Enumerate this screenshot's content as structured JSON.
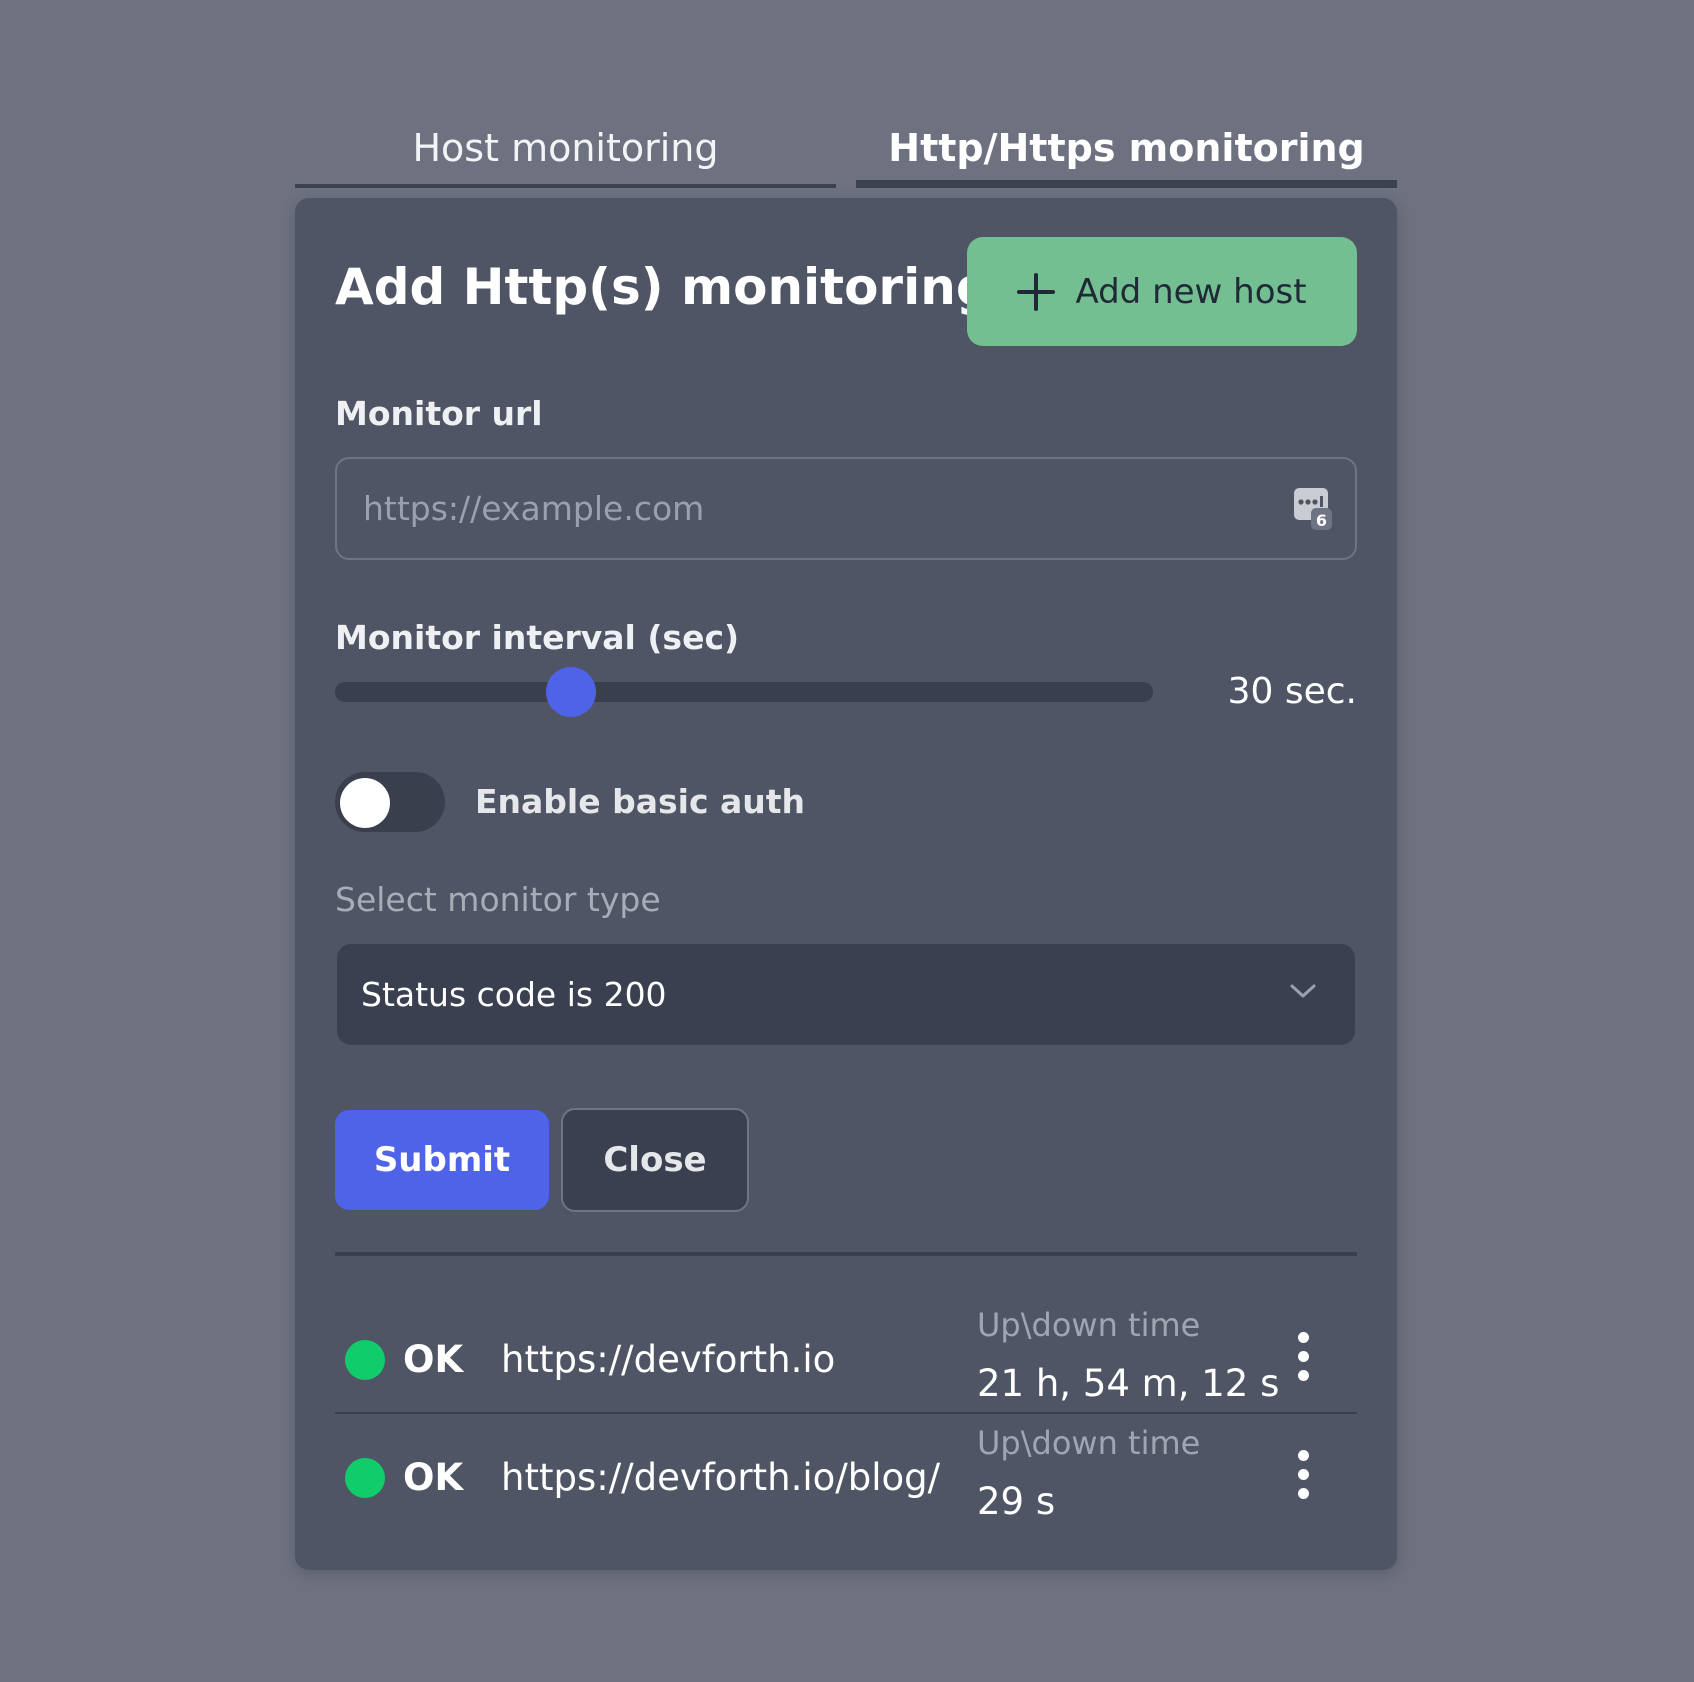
{
  "tabs": [
    {
      "label": "Host monitoring",
      "active": false
    },
    {
      "label": "Http/Https monitoring",
      "active": true
    }
  ],
  "form": {
    "title": "Add Http(s) monitoring",
    "add_button_label": "Add new host",
    "url_label": "Monitor url",
    "url_placeholder": "https://example.com",
    "url_value": "",
    "interval_label": "Monitor interval (sec)",
    "interval_value_text": "30 sec.",
    "interval_fraction": 0.26,
    "basic_auth_label": "Enable basic auth",
    "basic_auth_enabled": false,
    "monitor_type_label": "Select monitor type",
    "monitor_type_value": "Status code is 200",
    "submit_label": "Submit",
    "close_label": "Close",
    "password_badge": "6"
  },
  "monitors": [
    {
      "status": "OK",
      "url": "https://devforth.io",
      "uptime_label": "Up\\down time",
      "uptime": "21 h, 54 m, 12 s"
    },
    {
      "status": "OK",
      "url": "https://devforth.io/blog/",
      "uptime_label": "Up\\down time",
      "uptime": "29 s"
    }
  ],
  "colors": {
    "background": "#6e7280",
    "panel": "#4f5564",
    "accent": "#4f63e8",
    "add_button": "#74bf91",
    "status_ok": "#10cc6a"
  }
}
